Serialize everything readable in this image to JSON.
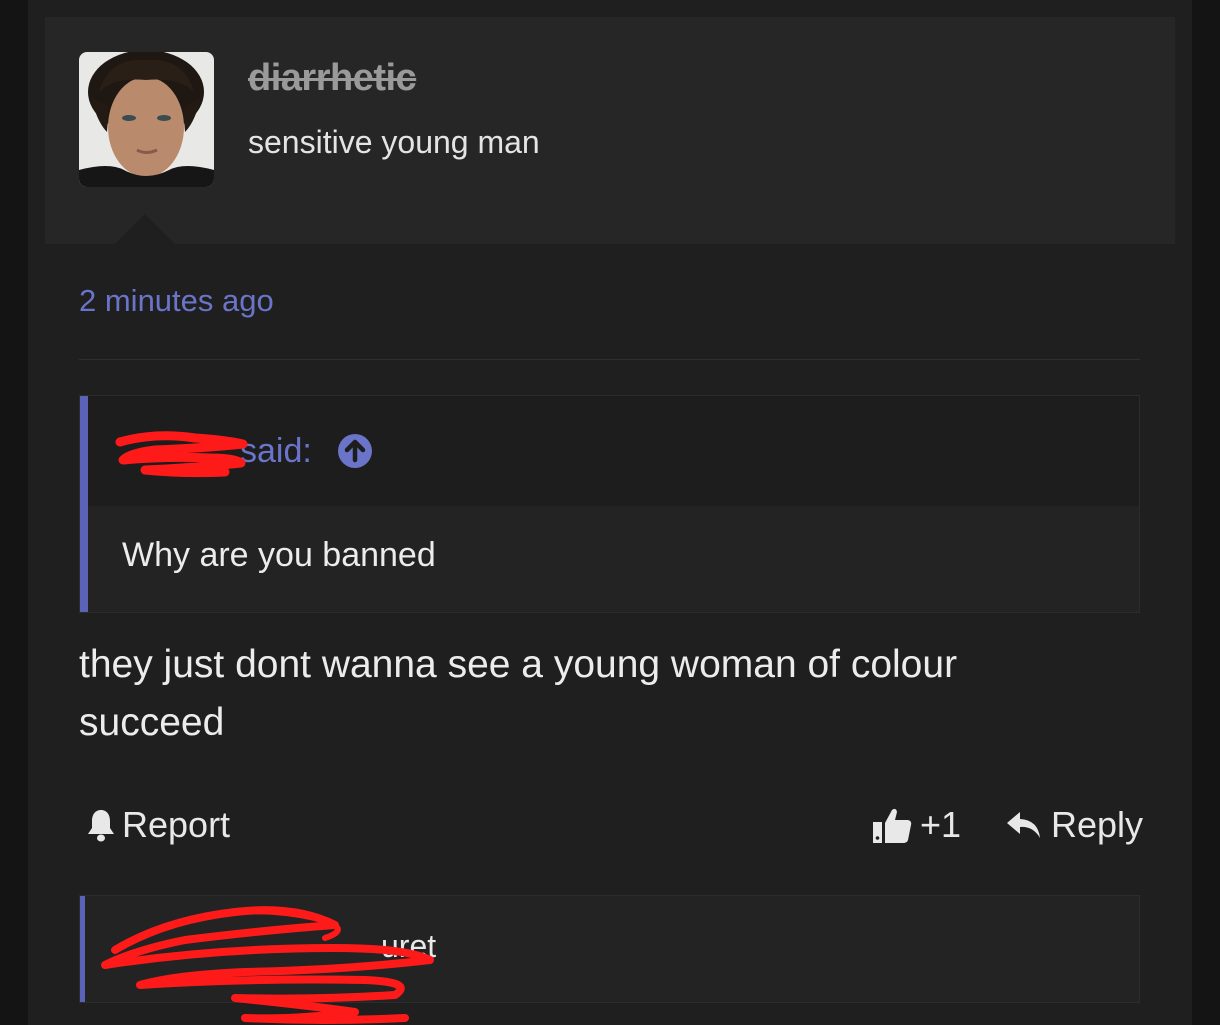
{
  "post": {
    "username": "diarrhetic",
    "user_title": "sensitive young man",
    "timestamp": "2 minutes ago",
    "quote": {
      "said_label": "said:",
      "body": "Why are you banned"
    },
    "message": "they just dont wanna see a young woman of colour succeed",
    "actions": {
      "report_label": "Report",
      "like_count": "+1",
      "reply_label": "Reply"
    }
  },
  "next_quote": {
    "partial_text": "uret"
  },
  "colors": {
    "accent": "#6a74c8",
    "quote_bar": "#5a63b8",
    "redaction": "#ff1a1a"
  },
  "icons": [
    "bell-icon",
    "thumbs-up-icon",
    "reply-arrow-icon",
    "arrow-up-circle-icon"
  ]
}
